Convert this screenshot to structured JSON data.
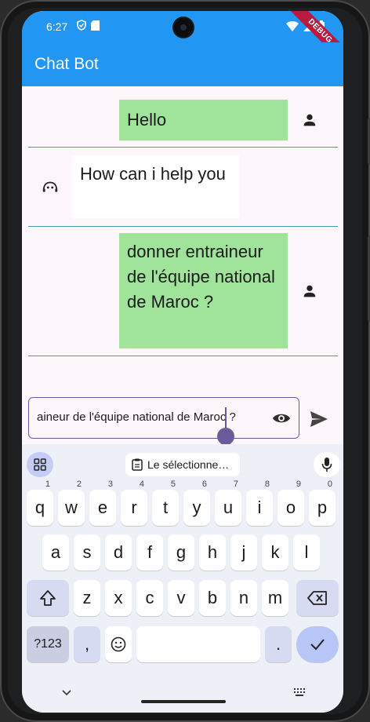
{
  "status_bar": {
    "time": "6:27"
  },
  "debug_ribbon": "DEBUG",
  "app_bar": {
    "title": "Chat Bot"
  },
  "messages": [
    {
      "sender": "user",
      "text": "Hello"
    },
    {
      "sender": "bot",
      "text": "How can i help you"
    },
    {
      "sender": "user",
      "text": "donner entraineur de l'équipe national de Maroc ?"
    }
  ],
  "input": {
    "value": "aineur de l'équipe national de Maroc ?"
  },
  "keyboard": {
    "clipboard_chip": "Le sélectionne…",
    "row1": [
      "q",
      "w",
      "e",
      "r",
      "t",
      "y",
      "u",
      "i",
      "o",
      "p"
    ],
    "row1_numbers": [
      "1",
      "2",
      "3",
      "4",
      "5",
      "6",
      "7",
      "8",
      "9",
      "0"
    ],
    "row2": [
      "a",
      "s",
      "d",
      "f",
      "g",
      "h",
      "j",
      "k",
      "l"
    ],
    "row3": [
      "z",
      "x",
      "c",
      "v",
      "b",
      "n",
      "m"
    ],
    "symbols_label": "?123",
    "comma": ",",
    "period": "."
  },
  "colors": {
    "app_bar": "#2196f3",
    "user_bubble": "#9fe49a",
    "bot_bubble": "#ffffff",
    "accent": "#6a5c9a"
  }
}
